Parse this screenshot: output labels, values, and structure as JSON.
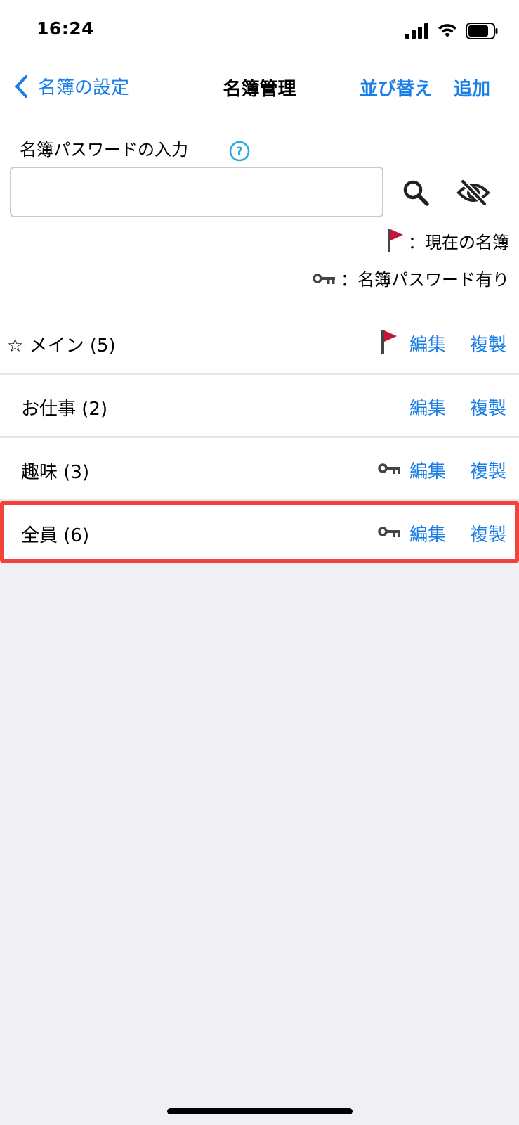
{
  "status_bar": {
    "time": "16:24"
  },
  "nav": {
    "back_label": "名簿の設定",
    "title": "名簿管理",
    "sort_label": "並び替え",
    "add_label": "追加"
  },
  "password": {
    "label": "名簿パスワードの入力",
    "value": "",
    "placeholder": ""
  },
  "legend": {
    "flag_text": "：現在の名簿",
    "key_text": "：名簿パスワード有り"
  },
  "rosters": [
    {
      "name": "☆ メイン (5)",
      "edit": "編集",
      "copy": "複製",
      "indicator": "flag"
    },
    {
      "name": "お仕事 (2)",
      "edit": "編集",
      "copy": "複製",
      "indicator": "none"
    },
    {
      "name": "趣味 (3)",
      "edit": "編集",
      "copy": "複製",
      "indicator": "key"
    },
    {
      "name": "全員 (6)",
      "edit": "編集",
      "copy": "複製",
      "indicator": "key",
      "highlighted": true
    }
  ],
  "colors": {
    "accent": "#1a7ee6",
    "flag": "#c2173d",
    "highlight": "#f2433b",
    "background": "#efeff4"
  }
}
